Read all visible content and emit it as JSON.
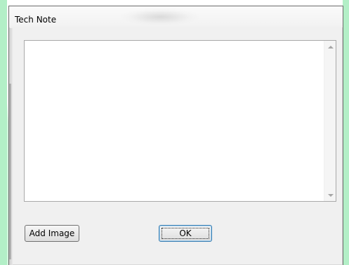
{
  "window": {
    "title": "Tech Note"
  },
  "note": {
    "text": ""
  },
  "buttons": {
    "add_image_label": "Add Image",
    "ok_label": "OK"
  },
  "icons": {
    "scroll_up": "scroll-up-arrow-icon",
    "scroll_down": "scroll-down-arrow-icon"
  },
  "colors": {
    "dialog_background": "#f0f0f0",
    "backdrop_accent": "#b3efc7",
    "ok_button_border": "#3c7fb1"
  }
}
